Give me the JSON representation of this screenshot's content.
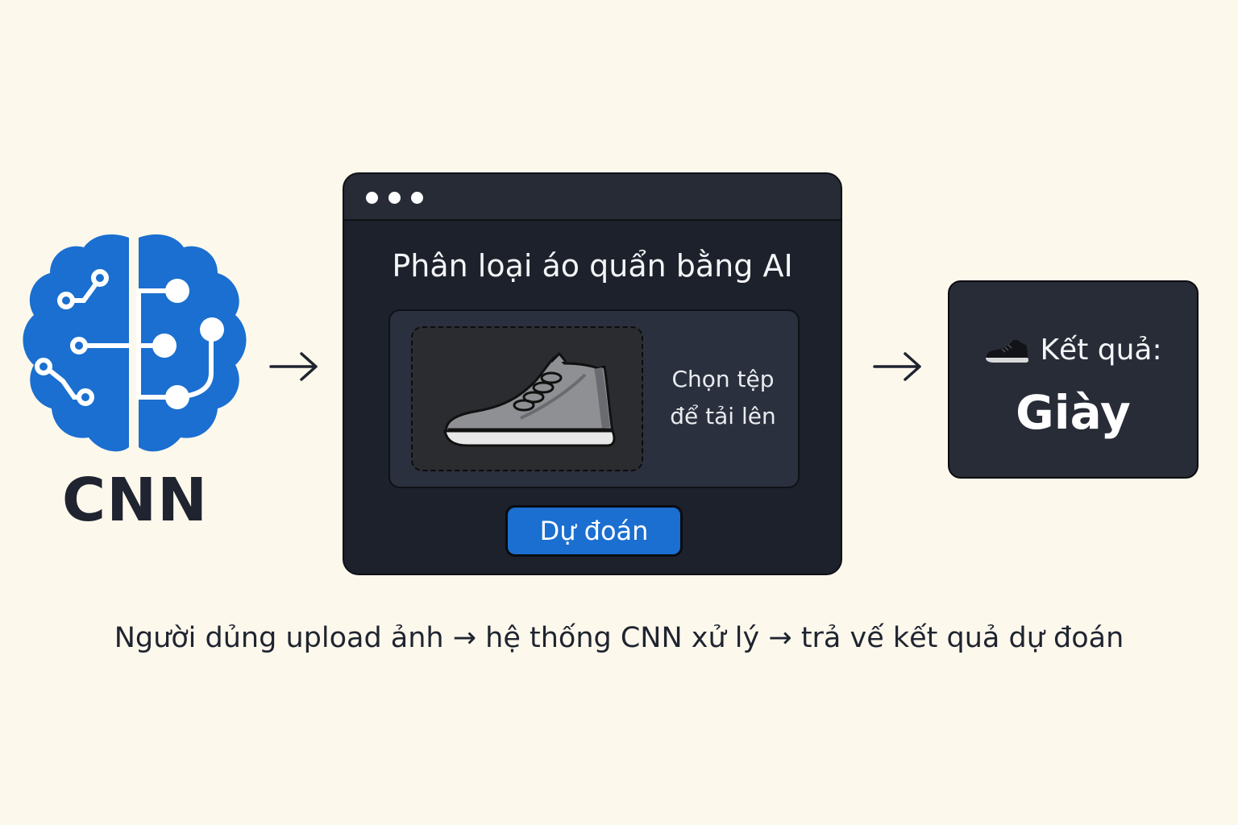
{
  "cnn_label": "CNN",
  "app": {
    "title": "Phân loại áo quẩn bằng AI",
    "upload_prompt_line1": "Chọn tệp",
    "upload_prompt_line2": "để tải lên",
    "predict_button": "Dự đoán"
  },
  "result": {
    "label": "Kết quả:",
    "value": "Giày"
  },
  "caption": "Người dủng upload ảnh → hệ thống CNN xử lý → trả vế kết quả dự đoán",
  "icons": {
    "brain": "brain-circuit-icon",
    "arrow": "arrow-right-icon",
    "upload_image": "sneaker-icon",
    "result": "shoe-emoji-icon"
  },
  "colors": {
    "background": "#fdf8ec",
    "brain_blue": "#1a6fd0",
    "window_dark": "#1d212b",
    "button_blue": "#1a6fd0",
    "text_dark": "#1f2430"
  }
}
